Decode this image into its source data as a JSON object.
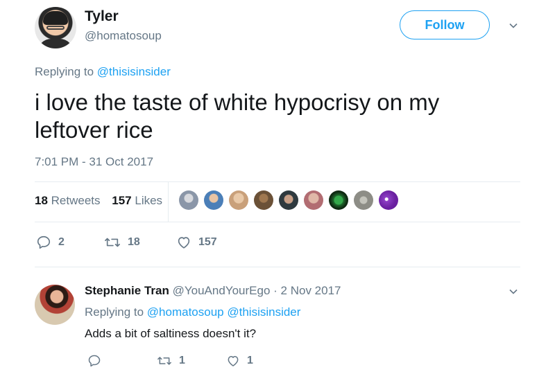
{
  "tweet": {
    "author_name": "Tyler",
    "author_handle": "@homatosoup",
    "follow_label": "Follow",
    "replying_prefix": "Replying to",
    "replying_to": "@thisisinsider",
    "text": "i love the taste of white hypocrisy on my leftover rice",
    "timestamp": "7:01 PM - 31 Oct 2017",
    "retweets_count": "18",
    "retweets_label": "Retweets",
    "likes_count": "157",
    "likes_label": "Likes",
    "actions": {
      "replies": "2",
      "retweets": "18",
      "likes": "157"
    }
  },
  "reply": {
    "author_name": "Stephanie Tran",
    "author_handle": "@YouAndYourEgo",
    "separator": "·",
    "date": "2 Nov 2017",
    "replying_prefix": "Replying to",
    "replying_to_1": "@homatosoup",
    "replying_to_2": "@thisisinsider",
    "text": "Adds a bit of saltiness doesn't it?",
    "actions": {
      "replies": "",
      "retweets": "1",
      "likes": "1"
    }
  },
  "colors": {
    "accent": "#1da1f2",
    "muted": "#657786",
    "text": "#14171a",
    "divider": "#e6ecf0",
    "likers": [
      "#8a96a8",
      "#4b7fb8",
      "#c9a07a",
      "#6b5137",
      "#2f3a3f",
      "#b26d72",
      "#1e6b2c",
      "#8d8d86",
      "#8d3fc4"
    ]
  },
  "icons": {
    "more": "chevron-down-icon",
    "reply": "reply-bubble-icon",
    "retweet": "retweet-arrows-icon",
    "like": "heart-icon"
  }
}
